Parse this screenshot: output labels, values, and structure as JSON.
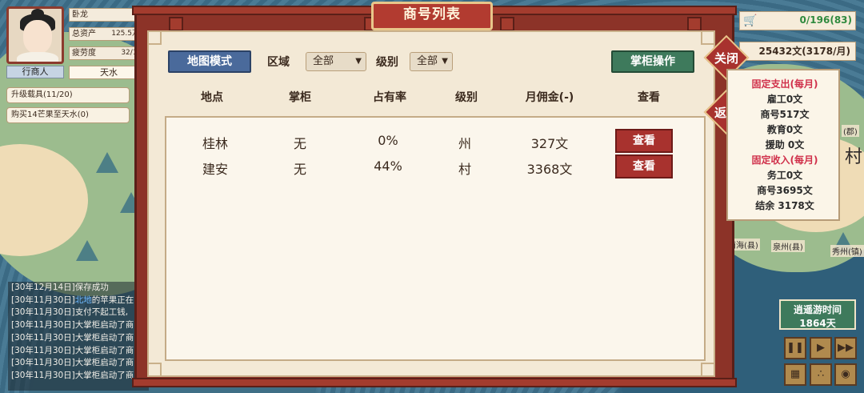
{
  "map": {
    "labels": [
      "泉州(县)",
      "南海(县)",
      "秀州(镇)",
      "(郡)",
      "村"
    ]
  },
  "player": {
    "name": "卧龙",
    "name_value": "40",
    "assets_label": "总资产",
    "assets_value": "125.5万文",
    "fatigue_label": "疲劳度",
    "fatigue_value": "32/100",
    "role": "行商人",
    "location": "天水"
  },
  "quests": [
    "升级载具(11/20)",
    "购买14芒果至天水(0)"
  ],
  "log": [
    {
      "prefix": "[30年12月14日]保存成功",
      "hl": "",
      "rest": ""
    },
    {
      "prefix": "[30年11月30日]",
      "hl": "北地",
      "rest": "的苹果正在"
    },
    {
      "prefix": "[30年11月30日]支付不起工钱,",
      "hl": "",
      "rest": ""
    },
    {
      "prefix": "[30年11月30日]大掌柜启动了商",
      "hl": "",
      "rest": ""
    },
    {
      "prefix": "[30年11月30日]大掌柜启动了商",
      "hl": "",
      "rest": ""
    },
    {
      "prefix": "[30年11月30日]大掌柜启动了商",
      "hl": "",
      "rest": ""
    },
    {
      "prefix": "[30年11月30日]大掌柜启动了商",
      "hl": "",
      "rest": ""
    },
    {
      "prefix": "[30年11月30日]大掌柜启动了商",
      "hl": "",
      "rest": ""
    }
  ],
  "dialog": {
    "title": "商号列表",
    "map_mode_button": "地图模式",
    "region_label": "区域",
    "region_value": "全部",
    "level_label": "级别",
    "level_value": "全部",
    "manager_ops_button": "掌柜操作",
    "columns": [
      "地点",
      "掌柜",
      "占有率",
      "级别",
      "月佣金(-)",
      "查看"
    ],
    "rows": [
      {
        "place": "桂林",
        "manager": "无",
        "share": "0%",
        "level": "州",
        "commission": "327文",
        "action": "查看"
      },
      {
        "place": "建安",
        "manager": "无",
        "share": "44%",
        "level": "村",
        "commission": "3368文",
        "action": "查看"
      }
    ]
  },
  "hud": {
    "cart_value": "0/196(83)",
    "money": "25432文(3178/月)",
    "close_label": "关闭",
    "back_label": "返回",
    "ledger": {
      "fixed_expense_title": "固定支出(每月)",
      "employee_expense": "雇工0文",
      "shop_expense": "商号517文",
      "education_expense": "教育0文",
      "aid_expense": "援助 0文",
      "fixed_income_title": "固定收入(每月)",
      "work_income": "务工0文",
      "shop_income": "商号3695文",
      "balance": "结余 3178文"
    },
    "time_label": "逍遥游时间",
    "time_value": "1864天"
  },
  "colors": {
    "frame": "#8c3328",
    "paper": "#f3e9d6",
    "blue_button": "#4a6a9b",
    "green_button": "#3e7a5c",
    "view_button": "#a8322e",
    "income_title": "#d0304a",
    "cart_value": "#2f8a3e"
  },
  "icons": [
    "cart-icon",
    "pause-icon",
    "play-icon",
    "fast-forward-icon",
    "map-icon",
    "footprints-icon",
    "location-pin-icon"
  ]
}
